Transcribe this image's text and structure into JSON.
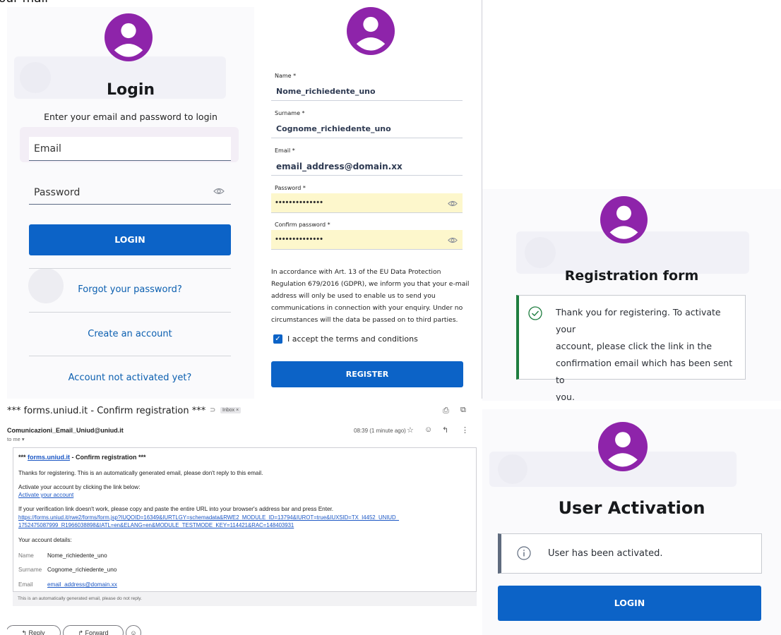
{
  "top_fragment": "our mail",
  "login": {
    "title": "Login",
    "subtitle": "Enter your email and password to login",
    "email_label": "Email",
    "password_label": "Password",
    "button": "LOGIN",
    "forgot": "Forgot your password?",
    "create": "Create an account",
    "not_activated": "Account not activated yet?"
  },
  "register": {
    "name_label": "Name *",
    "name_value": "Nome_richiedente_uno",
    "surname_label": "Surname *",
    "surname_value": "Cognome_richiedente_uno",
    "email_label": "Email *",
    "email_value": "email_address@domain.xx",
    "password_label": "Password *",
    "password_dots": "••••••••••••••",
    "confirm_label": "Confirm password *",
    "confirm_dots": "••••••••••••••",
    "gdpr_lines": [
      "In accordance with Art. 13 of the EU Data Protection",
      "Regulation 679/2016 (GDPR), we inform you that your e-mail",
      "address will only be used to enable us to send you",
      "communications in connection with your enquiry. Under no",
      "circumstances will the data be passed on to third parties."
    ],
    "accept": "I accept the terms and conditions",
    "button": "REGISTER"
  },
  "regform": {
    "title": "Registration form",
    "lines": [
      "Thank you for registering. To activate your",
      "account, please click the link in the",
      "confirmation email which has been sent to",
      "you."
    ],
    "accent": "#1e7d3f"
  },
  "email": {
    "subject": "*** forms.uniud.it - Confirm registration ***",
    "inbox_tag": "Inbox ×",
    "sender": "Comunicazioni_Email_Uniud@uniud.it",
    "to": "to me ▾",
    "time": "08:39 (1 minute ago)",
    "body_heading_prefix": "*** ",
    "body_heading_link": "forms.uniud.it",
    "body_heading_suffix": " - Confirm registration ***",
    "thanks": "Thanks for registering. This is an automatically generated email, please don't reply to this email.",
    "activate_prompt": "Activate your account by clicking the link below:",
    "activate_link": "Activate your account",
    "fallback": "If your verification link doesn't work, please copy and paste the entire URL into your browser's address bar and press Enter.",
    "url_line1": "https://forms.uniud.it/rwe2/forms/form.jsp?IUQOID=16349&IURTLGY=schemadata&RWE2_MODULE_ID=13794&IUROT=true&IUXSID=TX_I4452_UNIUD_",
    "url_line2": "1752475087999_R1966038898&IATL=en&ELANG=en&MODULE_TESTMODE_KEY=114421&RAC=148403931",
    "details_heading": "Your account details:",
    "details": [
      {
        "label": "Name",
        "value": "Nome_richiedente_uno",
        "link": false
      },
      {
        "label": "Surname",
        "value": "Cognome_richiedente_uno",
        "link": false
      },
      {
        "label": "Email",
        "value": "email_address@domain.xx",
        "link": true
      }
    ],
    "footer": "This is an automatically generated email, please do not reply.",
    "reply": "Reply",
    "forward": "Forward"
  },
  "activation": {
    "title": "User Activation",
    "message": "User has been activated.",
    "button": "LOGIN",
    "accent": "#5f6b7e"
  },
  "colors": {
    "primary": "#0c63c7",
    "avatar": "#8e24aa",
    "password_bg": "#fdf7cc"
  }
}
